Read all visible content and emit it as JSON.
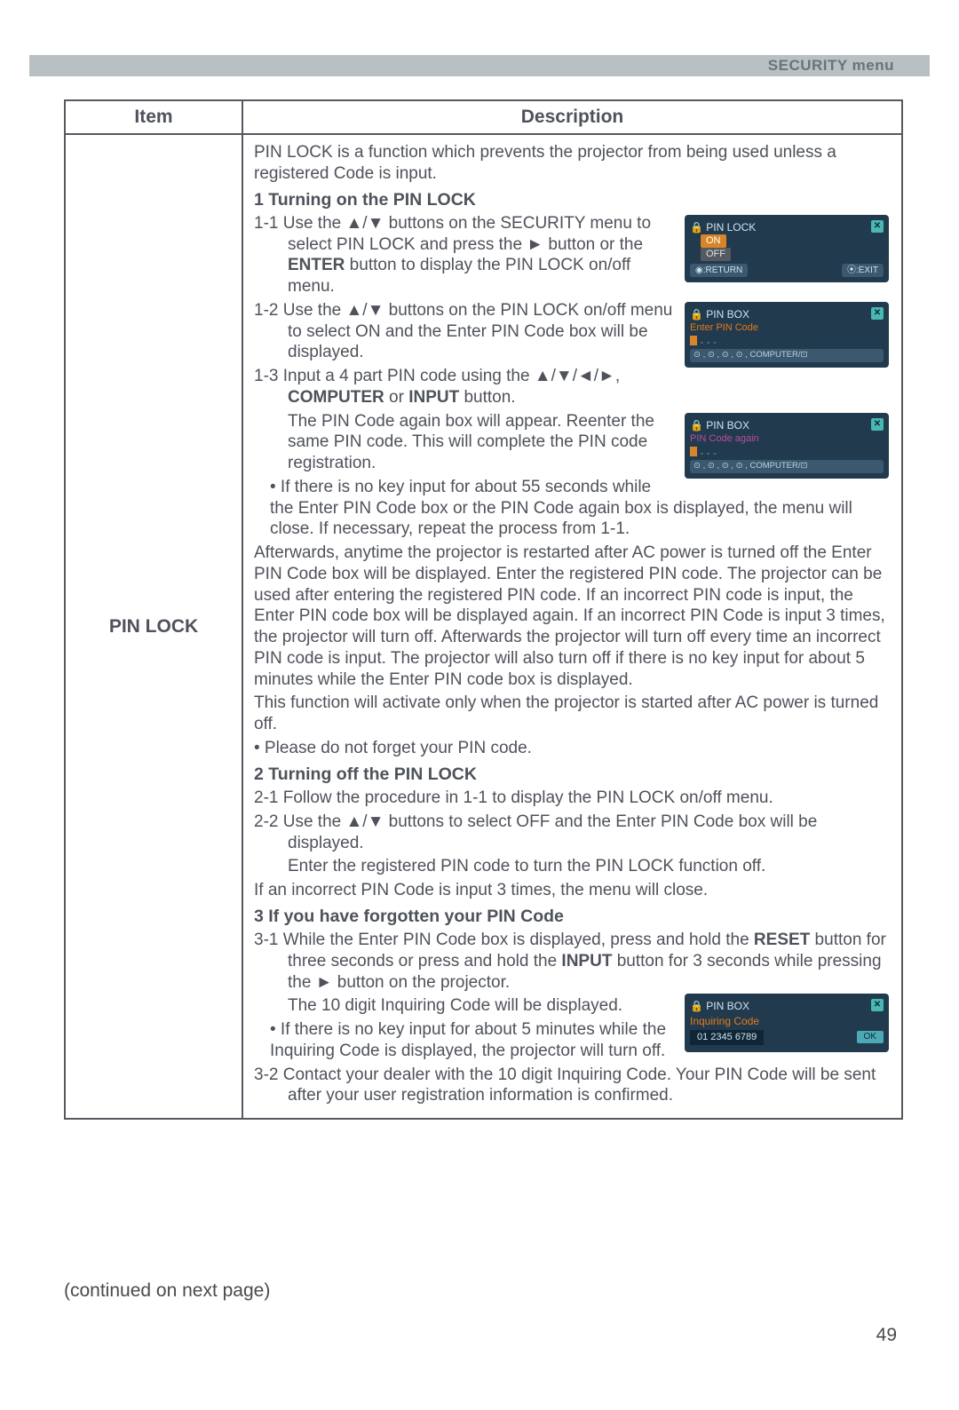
{
  "page": {
    "menu_tag": "SECURITY menu",
    "continued": "(continued on next page)",
    "number": "49"
  },
  "table": {
    "header_item": "Item",
    "header_desc": "Description",
    "item_label": "PIN LOCK"
  },
  "desc": {
    "intro": "PIN LOCK is a function which prevents the projector from being used unless a registered Code is input.",
    "h1": "1 Turning on the PIN LOCK",
    "p1_1a": "1-1 Use the ▲/▼ buttons on the SECURITY menu to select PIN LOCK and press the ► button or the ",
    "p1_1b": "ENTER",
    "p1_1c": " button to display the PIN LOCK on/off menu.",
    "p1_2": "1-2 Use the ▲/▼ buttons on the PIN LOCK on/off menu to select ON and the Enter PIN Code box will be displayed.",
    "p1_3a": "1-3 Input a 4 part PIN code using the ▲/▼/◄/►, ",
    "p1_3b": "COMPUTER",
    "p1_3c": " or ",
    "p1_3d": "INPUT",
    "p1_3e": " button.",
    "p1_3f": "The PIN Code again box will appear. Reenter the same PIN code. This will complete the PIN code registration.",
    "bullet1": "• If there is no key input for about 55 seconds while the Enter PIN Code box or the PIN Code again box is displayed, the menu will close. If necessary, repeat the process from 1-1.",
    "after": "Afterwards, anytime the projector is restarted after AC power  is turned off the Enter PIN Code box will be displayed. Enter the registered PIN code. The projector can be used after entering the registered PIN code. If an incorrect PIN code is input, the Enter PIN code box will be displayed again. If an incorrect PIN Code is input 3 times, the projector will turn off. Afterwards the projector will turn off every time an incorrect PIN code is input. The projector will also turn off if there is no key input for about 5 minutes while the Enter PIN code box is displayed.",
    "after2": "This function will activate only when the projector is started after AC power is turned off.",
    "bullet2": "• Please do not forget your PIN code.",
    "h2": "2 Turning off the PIN LOCK",
    "p2_1": "2-1 Follow the procedure in 1-1 to display the PIN LOCK on/off menu.",
    "p2_2": "2-2 Use the ▲/▼ buttons to select OFF and the Enter PIN Code box will be displayed.",
    "p2_2b": "Enter the registered PIN code to turn the PIN LOCK function off.",
    "p2_end": "If an incorrect PIN Code is input 3 times, the menu will close.",
    "h3": "3 If you have forgotten your PIN Code",
    "p3_1a": "3-1 While the Enter PIN Code box is displayed, press and hold the ",
    "p3_1b": "RESET",
    "p3_1c": " button for three seconds or press and hold the ",
    "p3_1d": "INPUT",
    "p3_1e": " button for 3 seconds while pressing the ► button on the projector.",
    "p3_1f": "The 10 digit Inquiring Code will be displayed.",
    "bullet3": "• If there is no key input for about 5 minutes while the Inquiring Code is displayed, the projector will turn off.",
    "p3_2": "3-2 Contact your dealer with the 10 digit Inquiring Code. Your PIN Code will be sent after your user registration information is confirmed."
  },
  "osd": {
    "pinlock_title": "PIN LOCK",
    "on": "ON",
    "off": "OFF",
    "return": "◉:RETURN",
    "exit": "⦿:EXIT",
    "pinbox_title": "PIN BOX",
    "enter_code": "Enter PIN Code",
    "nav": "⊙ , ⊙ , ⊙ , ⊙ , COMPUTER/⊡",
    "code_again": "PIN Code again",
    "inq_label": "Inquiring Code",
    "inq_code": "01 2345 6789",
    "ok": "OK"
  }
}
